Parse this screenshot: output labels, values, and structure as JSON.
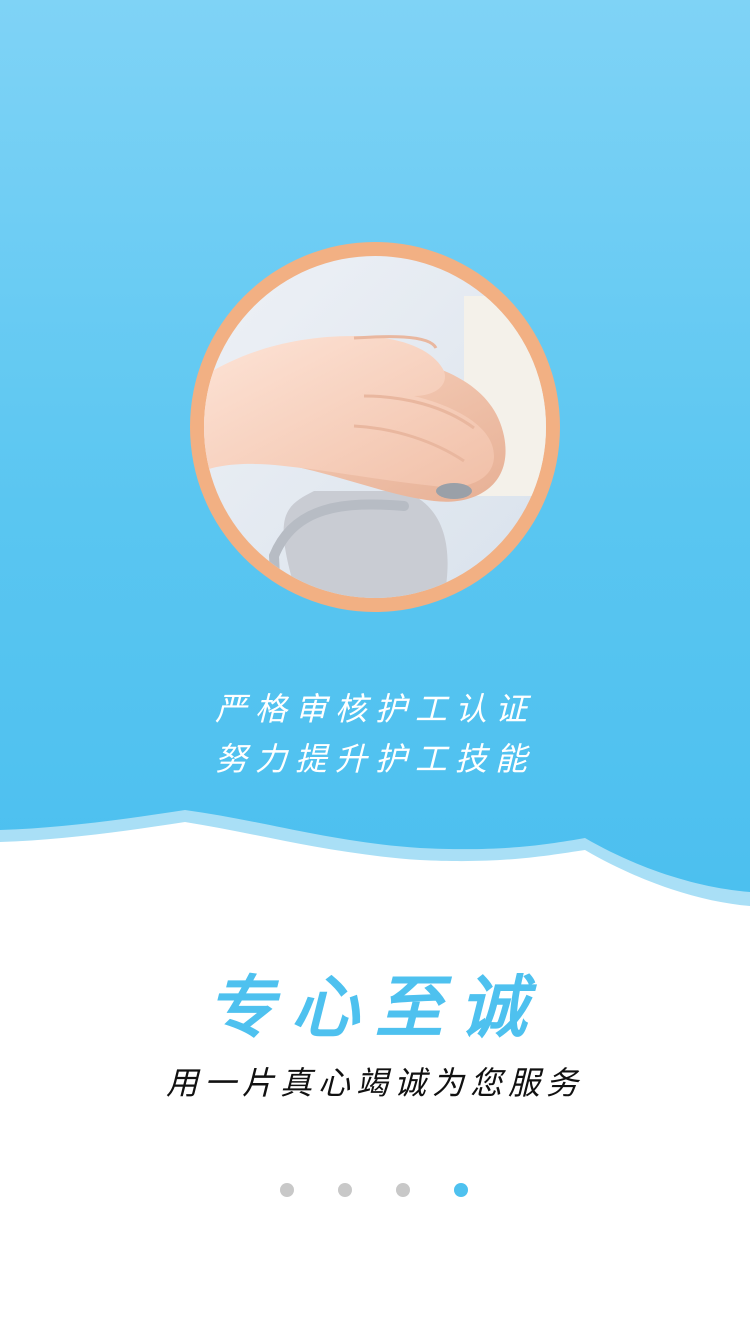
{
  "intro": {
    "tagline_line1": "严格审核护工认证",
    "tagline_line2": "努力提升护工技能",
    "headline": "专心至诚",
    "subline": "用一片真心竭诚为您服务"
  },
  "pager": {
    "total": 4,
    "active_index": 4
  },
  "colors": {
    "hero_top": "#7fd3f6",
    "hero_bottom": "#4bbfef",
    "ring": "#f2b083",
    "headline": "#4ec1ef",
    "dot_inactive": "#c8c8c8",
    "dot_active": "#4ec1ef"
  },
  "image": {
    "subject": "hands-on-walker-photo"
  }
}
